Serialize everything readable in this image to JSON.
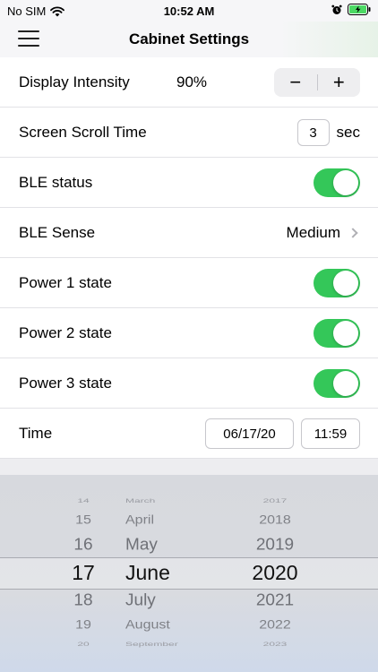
{
  "status_bar": {
    "carrier": "No SIM",
    "time": "10:52 AM"
  },
  "nav": {
    "title": "Cabinet Settings"
  },
  "settings": {
    "display_intensity": {
      "label": "Display Intensity",
      "value": "90%",
      "minus": "−",
      "plus": "+"
    },
    "scroll_time": {
      "label": "Screen Scroll Time",
      "value": "3",
      "unit": "sec"
    },
    "ble_status": {
      "label": "BLE status",
      "on": true
    },
    "ble_sense": {
      "label": "BLE Sense",
      "value": "Medium"
    },
    "power1": {
      "label": "Power 1 state",
      "on": true
    },
    "power2": {
      "label": "Power 2 state",
      "on": true
    },
    "power3": {
      "label": "Power 3 state",
      "on": true
    },
    "time": {
      "label": "Time",
      "date": "06/17/20",
      "clock": "11:59"
    }
  },
  "picker": {
    "days": [
      "14",
      "15",
      "16",
      "17",
      "18",
      "19",
      "20"
    ],
    "months": [
      "March",
      "April",
      "May",
      "June",
      "July",
      "August",
      "September"
    ],
    "years": [
      "2017",
      "2018",
      "2019",
      "2020",
      "2021",
      "2022",
      "2023"
    ]
  },
  "colors": {
    "toggle_on": "#34c759",
    "picker_bg": "#d7d9de"
  }
}
